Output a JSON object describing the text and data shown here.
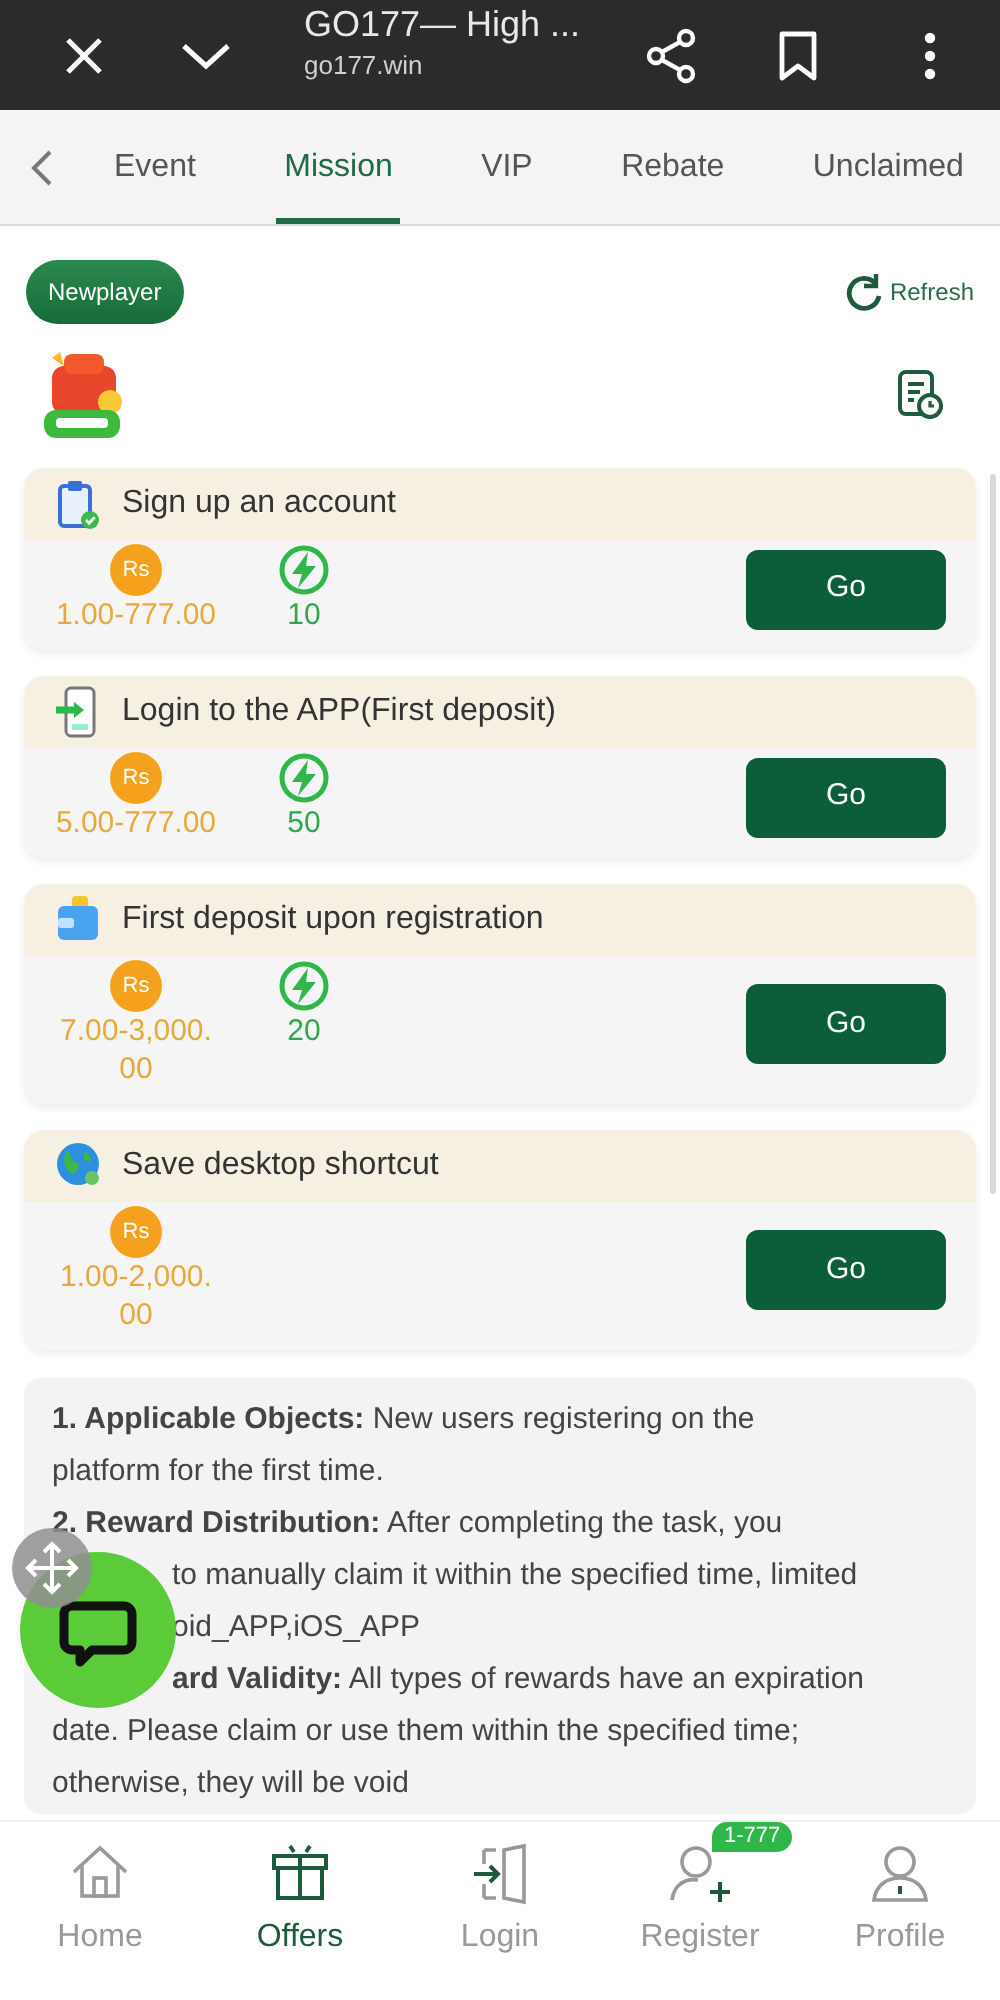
{
  "browser": {
    "title": "GO177— High ...",
    "url": "go177.win"
  },
  "tabs": [
    {
      "label": "Event",
      "selected": false
    },
    {
      "label": "Mission",
      "selected": true
    },
    {
      "label": "VIP",
      "selected": false
    },
    {
      "label": "Rebate",
      "selected": false
    },
    {
      "label": "Unclaimed",
      "selected": false
    }
  ],
  "category": {
    "label": "Newplayer"
  },
  "refresh": {
    "label": "Refresh"
  },
  "tasks": [
    {
      "kind": "clipboard",
      "title": "Sign up an account",
      "currency": "Rs",
      "reward": "1.00-777.00",
      "points": "10",
      "action": "Go"
    },
    {
      "kind": "phone",
      "title": "Login to the APP(First deposit)",
      "currency": "Rs",
      "reward": "5.00-777.00",
      "points": "50",
      "action": "Go"
    },
    {
      "kind": "wallet",
      "title": "First deposit upon registration",
      "currency": "Rs",
      "reward": "7.00-3,000.00",
      "points": "20",
      "action": "Go"
    },
    {
      "kind": "globe",
      "title": "Save desktop shortcut",
      "currency": "Rs",
      "reward": "1.00-2,000.00",
      "action": "Go"
    }
  ],
  "rules": {
    "lines_above": [
      "**1. Applicable Objects:** New users registering on the",
      "platform for the first time.",
      "**2. Reward Distribution:** After completing the task, you"
    ],
    "lines_beside_chat": [
      "to manually claim it within the specified time, limited",
      "oid_APP,iOS_APP",
      "**ard Validity:** All types of rewards have an expiration"
    ],
    "lines_below": [
      "date. Please claim or use them within the specified time;",
      "otherwise, they will be void"
    ]
  },
  "nav": [
    {
      "kind": "home",
      "label": "Home",
      "selected": false
    },
    {
      "kind": "gift",
      "label": "Offers",
      "selected": true
    },
    {
      "kind": "login",
      "label": "Login",
      "selected": false
    },
    {
      "kind": "register",
      "label": "Register",
      "selected": false,
      "badge": "1-777"
    },
    {
      "kind": "profile",
      "label": "Profile",
      "selected": false
    }
  ]
}
